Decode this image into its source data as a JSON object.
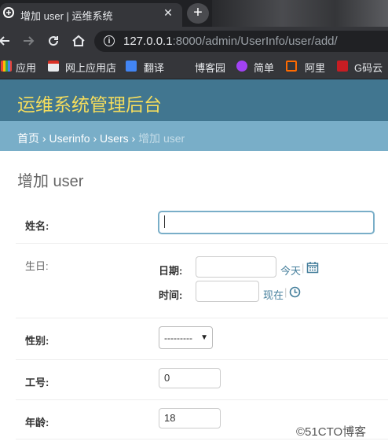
{
  "browser": {
    "tab_title": "增加 user | 运维系统",
    "new_tab_symbol": "+",
    "close_symbol": "✕",
    "url_host": "127.0.0.1",
    "url_rest": ":8000/admin/UserInfo/user/add/",
    "bookmarks": [
      "应用",
      "网上应用店",
      "翻译",
      "博客园",
      "简单",
      "阿里",
      "G码云"
    ]
  },
  "admin": {
    "site_title": "运维系统管理后台",
    "breadcrumb": {
      "home": "首页",
      "app": "Userinfo",
      "model": "Users",
      "current": "增加 user",
      "separator": "›"
    },
    "page_title": "增加 user"
  },
  "form": {
    "name_label": "姓名:",
    "birthday_label": "生日:",
    "date_label": "日期:",
    "today_link": "今天",
    "time_label": "时间:",
    "now_link": "现在",
    "divider": "|",
    "gender_label": "性别:",
    "gender_selected": "---------",
    "work_no_label": "工号:",
    "work_no_value": "0",
    "age_label": "年龄:",
    "age_value": "18"
  },
  "watermark": "©51CTO博客",
  "colors": {
    "header": "#417690",
    "brand": "#f5dd5d",
    "breadcrumb_bar": "#79aec8",
    "link": "#447e9b"
  }
}
